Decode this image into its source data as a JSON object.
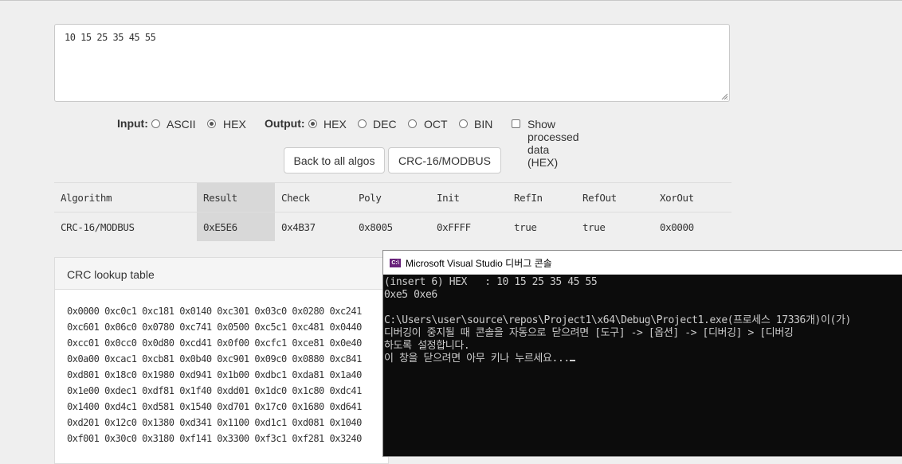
{
  "input_text": "10 15 25 35 45 55",
  "options": {
    "input_label": "Input:",
    "input_ascii": "ASCII",
    "input_hex": "HEX",
    "output_label": "Output:",
    "output_hex": "HEX",
    "output_dec": "DEC",
    "output_oct": "OCT",
    "output_bin": "BIN",
    "show_processed": "Show processed data (HEX)"
  },
  "buttons": {
    "back": "Back to all algos",
    "algo": "CRC-16/MODBUS"
  },
  "table": {
    "headers": [
      "Algorithm",
      "Result",
      "Check",
      "Poly",
      "Init",
      "RefIn",
      "RefOut",
      "XorOut"
    ],
    "row": [
      "CRC-16/MODBUS",
      "0xE5E6",
      "0x4B37",
      "0x8005",
      "0xFFFF",
      "true",
      "true",
      "0x0000"
    ]
  },
  "lookup": {
    "title": "CRC lookup table",
    "rows": [
      "0x0000 0xc0c1 0xc181 0x0140 0xc301 0x03c0 0x0280 0xc241",
      "0xc601 0x06c0 0x0780 0xc741 0x0500 0xc5c1 0xc481 0x0440",
      "0xcc01 0x0cc0 0x0d80 0xcd41 0x0f00 0xcfc1 0xce81 0x0e40",
      "0x0a00 0xcac1 0xcb81 0x0b40 0xc901 0x09c0 0x0880 0xc841",
      "0xd801 0x18c0 0x1980 0xd941 0x1b00 0xdbc1 0xda81 0x1a40",
      "0x1e00 0xdec1 0xdf81 0x1f40 0xdd01 0x1dc0 0x1c80 0xdc41",
      "0x1400 0xd4c1 0xd581 0x1540 0xd701 0x17c0 0x1680 0xd641",
      "0xd201 0x12c0 0x1380 0xd341 0x1100 0xd1c1 0xd081 0x1040",
      "0xf001 0x30c0 0x3180 0xf141 0x3300 0xf3c1 0xf281 0x3240"
    ]
  },
  "console": {
    "icon": "C:\\",
    "title": "Microsoft Visual Studio 디버그 콘솔",
    "lines": [
      "(insert 6) HEX   : 10 15 25 35 45 55",
      "0xe5 0xe6",
      "",
      "C:\\Users\\user\\source\\repos\\Project1\\x64\\Debug\\Project1.exe(프로세스 17336개)이(가)",
      "디버깅이 중지될 때 콘솔을 자동으로 닫으려면 [도구] -> [옵션] -> [디버깅] > [디버깅",
      "하도록 설정합니다.",
      "이 창을 닫으려면 아무 키나 누르세요..."
    ]
  }
}
